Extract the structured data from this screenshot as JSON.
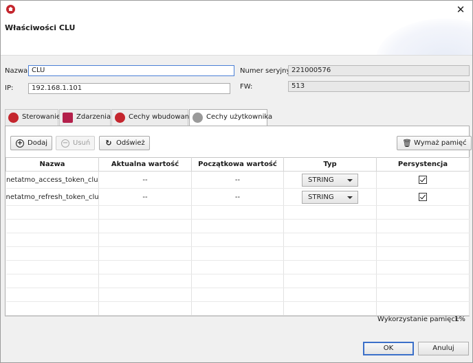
{
  "window": {
    "title": ""
  },
  "header": {
    "title": "Właściwości CLU"
  },
  "form": {
    "name_label": "Nazwa:",
    "name_value": "CLU",
    "ip_label": "IP:",
    "ip_value": "192.168.1.101",
    "serial_label": "Numer seryjny:",
    "serial_value": "221000576",
    "fw_label": "FW:",
    "fw_value": "513"
  },
  "tabs": [
    {
      "label": "Sterowanie",
      "icon": "control-icon",
      "color": "#c4262e"
    },
    {
      "label": "Zdarzenia",
      "icon": "events-icon",
      "color": "#b3204b"
    },
    {
      "label": "Cechy wbudowane",
      "icon": "builtin-features-icon",
      "color": "#c4262e"
    },
    {
      "label": "Cechy użytkownika",
      "icon": "user-features-icon",
      "color": "#8a8a8a",
      "active": true
    }
  ],
  "toolbar": {
    "add_label": "Dodaj",
    "remove_label": "Usuń",
    "refresh_label": "Odśwież",
    "clear_memory_label": "Wymaż pamięć"
  },
  "table": {
    "columns": [
      "Nazwa",
      "Aktualna wartość",
      "Początkowa wartość",
      "Typ",
      "Persystencja"
    ],
    "rows": [
      {
        "name": "netatmo_access_token_clu",
        "current": "--",
        "initial": "--",
        "type": "STRING",
        "persistent": true
      },
      {
        "name": "netatmo_refresh_token_clu",
        "current": "--",
        "initial": "--",
        "type": "STRING",
        "persistent": true
      }
    ]
  },
  "memory": {
    "label": "Wykorzystanie pamięci:",
    "value": "1%"
  },
  "dialog": {
    "ok_label": "OK",
    "cancel_label": "Anuluj"
  },
  "colors": {
    "accent": "#3a6fc9",
    "brand": "#c4262e"
  }
}
